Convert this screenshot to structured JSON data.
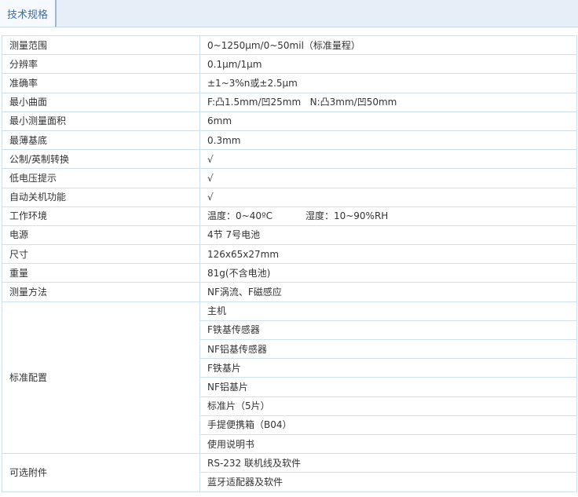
{
  "tab": {
    "label": "技术规格"
  },
  "specs": [
    {
      "label": "测量范围",
      "value": "0~1250μm/0~50mil（标准量程）"
    },
    {
      "label": "分辨率",
      "value": "0.1μm/1μm"
    },
    {
      "label": "准确率",
      "value": "±1~3%n或±2.5μm"
    },
    {
      "label": "最小曲面",
      "value": "F:凸1.5mm/凹25mm   N:凸3mm/凹50mm"
    },
    {
      "label": "最小测量面积",
      "value": "6mm"
    },
    {
      "label": "最薄基底",
      "value": "0.3mm"
    },
    {
      "label": "公制/英制转换",
      "value": "√"
    },
    {
      "label": "低电压提示",
      "value": "√"
    },
    {
      "label": "自动关机功能",
      "value": "√"
    },
    {
      "label": "工作环境",
      "value": "温度：0~40ºC           湿度：10~90%RH"
    },
    {
      "label": "电源",
      "value": "4节 7号电池"
    },
    {
      "label": "尺寸",
      "value": "126x65x27mm"
    },
    {
      "label": "重量",
      "value": "81g(不含电池)"
    },
    {
      "label": "测量方法",
      "value": "NF涡流、F磁感应"
    }
  ],
  "standard": {
    "label": "标准配置",
    "items": [
      "主机",
      "F铁基传感器",
      "NF铝基传感器",
      "F铁基片",
      "NF铝基片",
      "标准片（5片）",
      "手提便携箱（B04）",
      "使用说明书"
    ]
  },
  "optional": {
    "label": "可选附件",
    "items": [
      "RS-232 联机线及软件",
      "蓝牙适配器及软件"
    ]
  }
}
